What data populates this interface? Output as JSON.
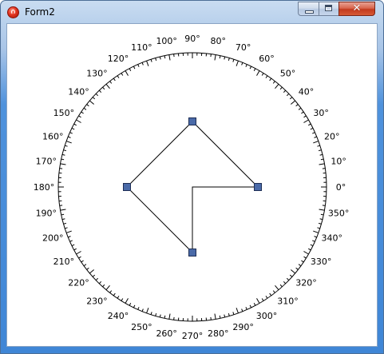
{
  "window": {
    "title": "Form2",
    "icon": "app-icon",
    "controls": {
      "minimize_icon": "minimize-icon",
      "maximize_icon": "maximize-icon",
      "close_glyph": "✕"
    }
  },
  "dial": {
    "degree_labels": [
      "0°",
      "10°",
      "20°",
      "30°",
      "40°",
      "50°",
      "60°",
      "70°",
      "80°",
      "90°",
      "100°",
      "110°",
      "120°",
      "130°",
      "140°",
      "150°",
      "160°",
      "170°",
      "180°",
      "190°",
      "200°",
      "210°",
      "220°",
      "230°",
      "240°",
      "250°",
      "260°",
      "270°",
      "280°",
      "290°",
      "300°",
      "310°",
      "320°",
      "330°",
      "340°",
      "350°"
    ],
    "handle_angles": [
      0,
      90,
      180,
      270
    ],
    "handle_fill": "#4a6aa8",
    "handle_stroke": "#1e2e55"
  }
}
